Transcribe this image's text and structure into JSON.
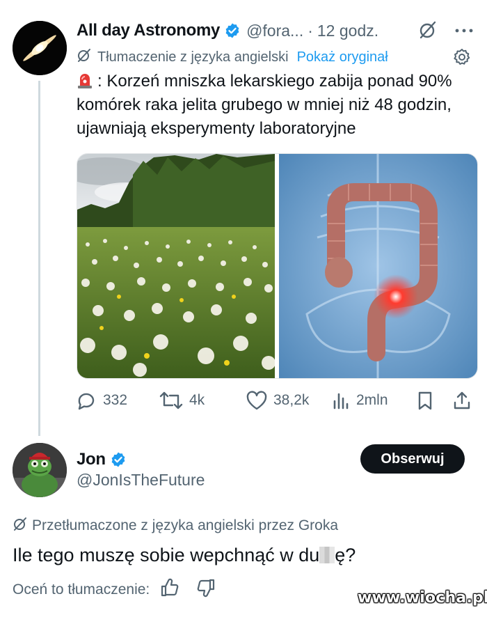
{
  "tweet": {
    "author_name": "All day Astronomy",
    "handle": "@fora...",
    "separator": "·",
    "time": "12 godz.",
    "translation_note": "Tłumaczenie z języka angielski",
    "show_original": "Pokaż oryginał",
    "text": ": Korzeń mniszka lekarskiego zabija ponad 90% komórek raka jelita grubego w mniej niż 48 godzin, ujawniają eksperymenty laboratoryjne",
    "media": [
      "dandelion-meadow-photo",
      "colon-illustration"
    ],
    "stats": {
      "replies": "332",
      "reposts": "4k",
      "likes": "38,2k",
      "views": "2mln"
    }
  },
  "reply": {
    "author_name": "Jon",
    "handle": "@JonIsTheFuture",
    "follow_label": "Obserwuj",
    "translation_note": "Przetłumaczone z języka angielski przez Groka",
    "text_before": "Ile tego muszę sobie wepchnąć w du",
    "text_after": "ę?",
    "rate_label": "Oceń to tłumaczenie:"
  },
  "watermark": "www.wiocha.pl",
  "colors": {
    "accent": "#1d9bf0",
    "text": "#0f1419",
    "muted": "#536471",
    "button": "#0f1419"
  },
  "icons": [
    "verified-badge-icon",
    "grok-icon",
    "more-icon",
    "translate-icon",
    "settings-icon",
    "siren-emoji-icon",
    "reply-icon",
    "repost-icon",
    "like-icon",
    "views-icon",
    "bookmark-icon",
    "share-icon",
    "thumbs-up-icon",
    "thumbs-down-icon"
  ]
}
